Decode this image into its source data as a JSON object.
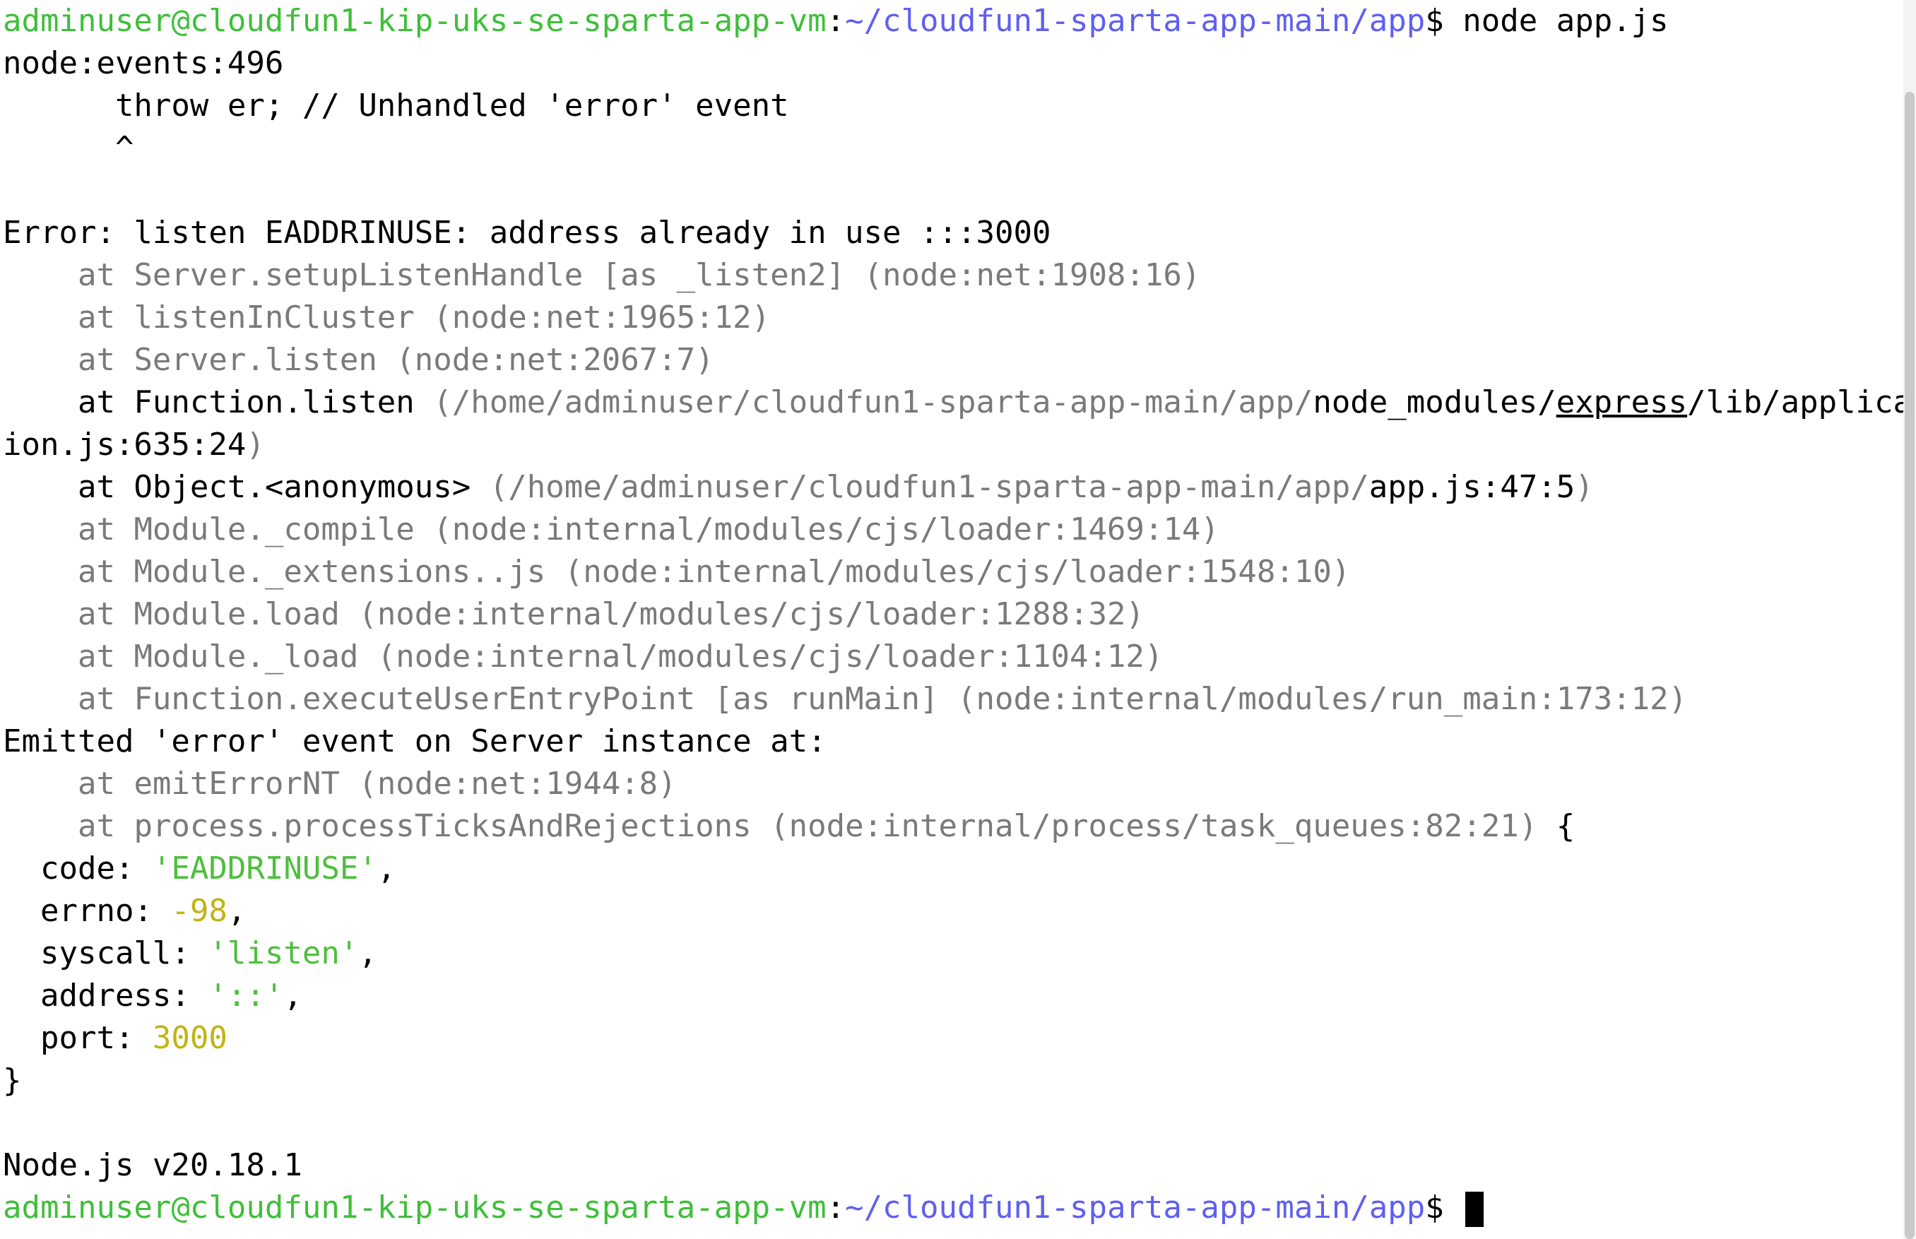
{
  "prompt": {
    "user_host": "adminuser@cloudfun1-kip-uks-se-sparta-app-vm",
    "colon": ":",
    "path": "~/cloudfun1-sparta-app-main/app",
    "symbol": "$ ",
    "command": "node app.js"
  },
  "output": {
    "events_line": "node:events:496",
    "throw_line": "      throw er; // Unhandled 'error' event",
    "caret_line": "      ^",
    "error_line": "Error: listen EADDRINUSE: address already in use :::3000",
    "trace": [
      {
        "at": "    at ",
        "fn": "Server.setupListenHandle [as _listen2] ",
        "loc": "(node:net:1908:16)"
      },
      {
        "at": "    at ",
        "fn": "listenInCluster ",
        "loc": "(node:net:1965:12)"
      },
      {
        "at": "    at ",
        "fn": "Server.listen ",
        "loc": "(node:net:2067:7)"
      }
    ],
    "function_listen": {
      "at": "    at Function.listen ",
      "path_gray": "(/home/adminuser/cloudfun1-sparta-app-main/app/",
      "nm": "node_modules/",
      "express": "express",
      "rest": "/lib/applicat",
      "wrap": "ion.js:635:24",
      "close": ")"
    },
    "object_anon": {
      "at": "    at Object.<anonymous> ",
      "path_gray": "(/home/adminuser/cloudfun1-sparta-app-main/app/",
      "file": "app.js:47:5",
      "close": ")"
    },
    "trace2": [
      {
        "at": "    at ",
        "fn": "Module._compile ",
        "loc": "(node:internal/modules/cjs/loader:1469:14)"
      },
      {
        "at": "    at ",
        "fn": "Module._extensions..js ",
        "loc": "(node:internal/modules/cjs/loader:1548:10)"
      },
      {
        "at": "    at ",
        "fn": "Module.load ",
        "loc": "(node:internal/modules/cjs/loader:1288:32)"
      },
      {
        "at": "    at ",
        "fn": "Module._load ",
        "loc": "(node:internal/modules/cjs/loader:1104:12)"
      },
      {
        "at": "    at ",
        "fn": "Function.executeUserEntryPoint [as runMain] ",
        "loc": "(node:internal/modules/run_main:173:12)"
      }
    ],
    "emitted_line": "Emitted 'error' event on Server instance at:",
    "trace3": [
      {
        "at": "    at ",
        "fn": "emitErrorNT ",
        "loc": "(node:net:1944:8)"
      },
      {
        "at": "    at ",
        "fn": "process.processTicksAndRejections ",
        "loc": "(node:internal/process/task_queues:82:21)",
        "tail": " {"
      }
    ],
    "props": [
      {
        "key": "  code: ",
        "value": "'EADDRINUSE'",
        "kind": "string",
        "tail": ","
      },
      {
        "key": "  errno: ",
        "value": "-98",
        "kind": "number",
        "tail": ","
      },
      {
        "key": "  syscall: ",
        "value": "'listen'",
        "kind": "string",
        "tail": ","
      },
      {
        "key": "  address: ",
        "value": "'::'",
        "kind": "string",
        "tail": ","
      },
      {
        "key": "  port: ",
        "value": "3000",
        "kind": "number",
        "tail": ""
      }
    ],
    "close_brace": "}",
    "node_version": "Node.js v20.18.1"
  },
  "colors": {
    "prompt_green": "#3fbf3a",
    "prompt_blue": "#5f5ff2",
    "trace_gray": "#7a7a7a",
    "string_green": "#4dbf3c",
    "number_yellow": "#c2b414"
  }
}
